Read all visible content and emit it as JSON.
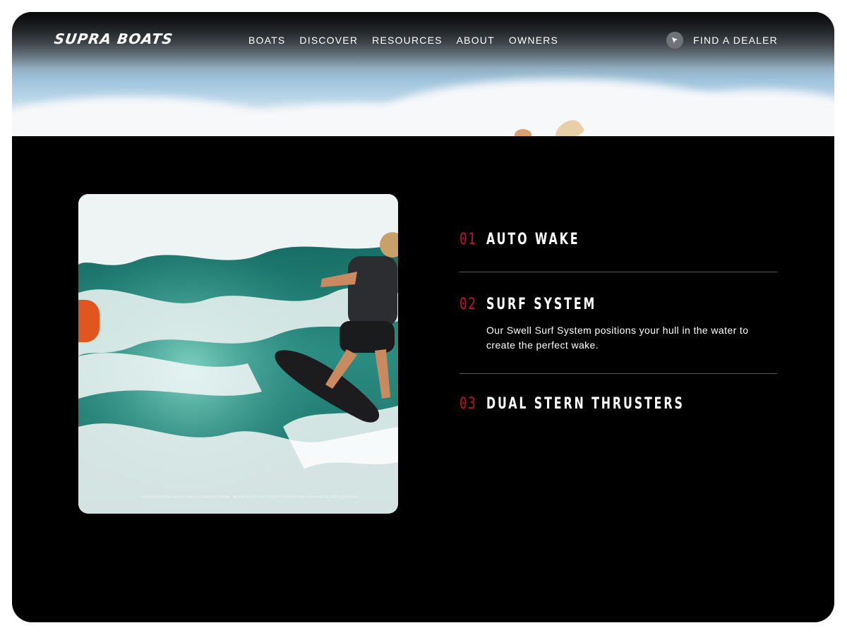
{
  "brand": {
    "logo_text": "SUPRA BOATS"
  },
  "nav": {
    "items": [
      {
        "label": "BOATS"
      },
      {
        "label": "DISCOVER"
      },
      {
        "label": "RESOURCES"
      },
      {
        "label": "ABOUT"
      },
      {
        "label": "OWNERS"
      }
    ],
    "dealer_label": "FIND A DEALER",
    "dealer_icon": "location-arrow-icon"
  },
  "media": {
    "caption": "PROFESSIONAL RIDER ON A CLOSED COURSE · ALWAYS FOLLOW SAFETY GUIDELINES AND LOCAL REGULATIONS"
  },
  "features": [
    {
      "number": "01",
      "title": "AUTO WAKE",
      "description": ""
    },
    {
      "number": "02",
      "title": "SURF SYSTEM",
      "description": "Our Swell Surf System positions your hull in the water to create the perfect wake."
    },
    {
      "number": "03",
      "title": "DUAL STERN THRUSTERS",
      "description": ""
    }
  ],
  "colors": {
    "accent": "#c8102e",
    "background": "#000000",
    "text": "#ffffff",
    "divider": "#5a5a5a"
  }
}
